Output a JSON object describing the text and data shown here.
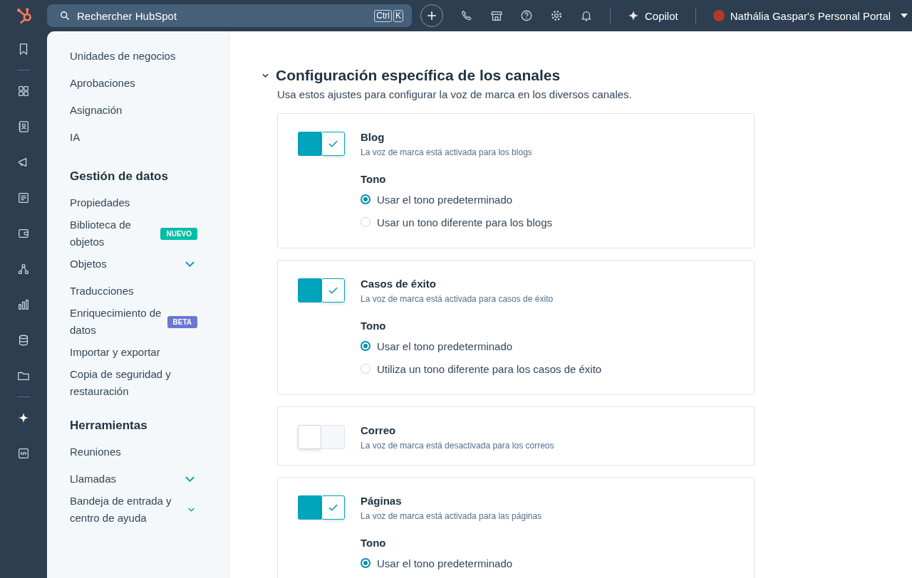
{
  "topbar": {
    "search": {
      "placeholder": "Rechercher HubSpot"
    },
    "shortcut_keys": [
      "Ctrl",
      "K"
    ],
    "copilot": "Copilot",
    "portal": "Nathália Gaspar's Personal Portal"
  },
  "sidebar": {
    "groups": [
      {
        "items": [
          {
            "label": "Unidades de negocios"
          },
          {
            "label": "Aprobaciones"
          },
          {
            "label": "Asignación"
          },
          {
            "label": "IA"
          }
        ]
      },
      {
        "heading": "Gestión de datos",
        "items": [
          {
            "label": "Propiedades"
          },
          {
            "label": "Biblioteca de objetos",
            "badge": {
              "text": "NUEVO",
              "color": "#00bda5"
            }
          },
          {
            "label": "Objetos",
            "expandable": true
          },
          {
            "label": "Traducciones"
          },
          {
            "label": "Enriquecimiento de datos",
            "badge": {
              "text": "BETA",
              "color": "#6a78d1"
            }
          },
          {
            "label": "Importar y exportar"
          },
          {
            "label": "Copia de seguridad y restauración"
          }
        ]
      },
      {
        "heading": "Herramientas",
        "items": [
          {
            "label": "Reuniones"
          },
          {
            "label": "Llamadas",
            "expandable": true
          },
          {
            "label": "Bandeja de entrada y centro de ayuda",
            "expandable": true
          }
        ]
      }
    ]
  },
  "section": {
    "title": "Configuración específica de los canales",
    "expanded": true,
    "description": "Usa estos ajustes para configurar la voz de marca en los diversos canales.",
    "channels": [
      {
        "name": "Blog",
        "status": "La voz de marca está activada para los blogs",
        "enabled": true,
        "tone_label": "Tono",
        "options": [
          {
            "label": "Usar el tono predeterminado",
            "selected": true
          },
          {
            "label": "Usar un tono diferente para los blogs",
            "selected": false
          }
        ]
      },
      {
        "name": "Casos de éxito",
        "status": "La voz de marca está activada para casos de éxito",
        "enabled": true,
        "tone_label": "Tono",
        "options": [
          {
            "label": "Usar el tono predeterminado",
            "selected": true
          },
          {
            "label": "Utiliza un tono diferente para los casos de éxito",
            "selected": false
          }
        ]
      },
      {
        "name": "Correo",
        "status": "La voz de marca está desactivada para los correos",
        "enabled": false
      },
      {
        "name": "Páginas",
        "status": "La voz de marca está activada para las páginas",
        "enabled": true,
        "tone_label": "Tono",
        "options": [
          {
            "label": "Usar el tono predeterminado",
            "selected": true
          }
        ]
      }
    ]
  }
}
